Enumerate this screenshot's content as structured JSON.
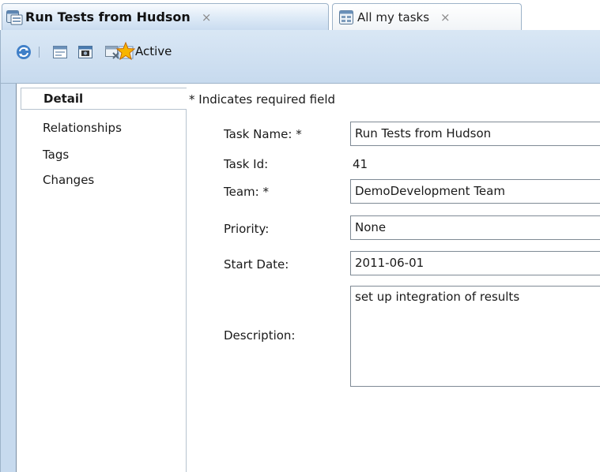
{
  "tabs": [
    {
      "label": "Run Tests from Hudson",
      "close": "×",
      "icon": "task-icon",
      "active": true
    },
    {
      "label": "All my tasks",
      "close": "×",
      "icon": "task-list-icon",
      "active": false
    }
  ],
  "toolbar": {
    "icons": [
      "refresh-icon",
      "open-in-browser-icon",
      "save-icon",
      "discard-icon",
      "favorite-star-icon"
    ],
    "state_label": "Active"
  },
  "sidenav": {
    "items": [
      {
        "label": "Detail",
        "selected": true
      },
      {
        "label": "Relationships",
        "selected": false
      },
      {
        "label": "Tags",
        "selected": false
      },
      {
        "label": "Changes",
        "selected": false
      }
    ]
  },
  "form": {
    "required_note": "* Indicates required field",
    "task_name_label": "Task Name: *",
    "task_name_value": "Run Tests from Hudson",
    "task_id_label": "Task Id:",
    "task_id_value": "41",
    "team_label": "Team: *",
    "team_value": "DemoDevelopment Team",
    "priority_label": "Priority:",
    "priority_value": "None",
    "start_date_label": "Start Date:",
    "start_date_value": "2011-06-01",
    "description_label": "Description:",
    "description_value": "set up integration of results"
  },
  "colors": {
    "toolbar_bg": "#c7daee",
    "tab_border": "#9db3c9",
    "field_border": "#7f8a95"
  }
}
